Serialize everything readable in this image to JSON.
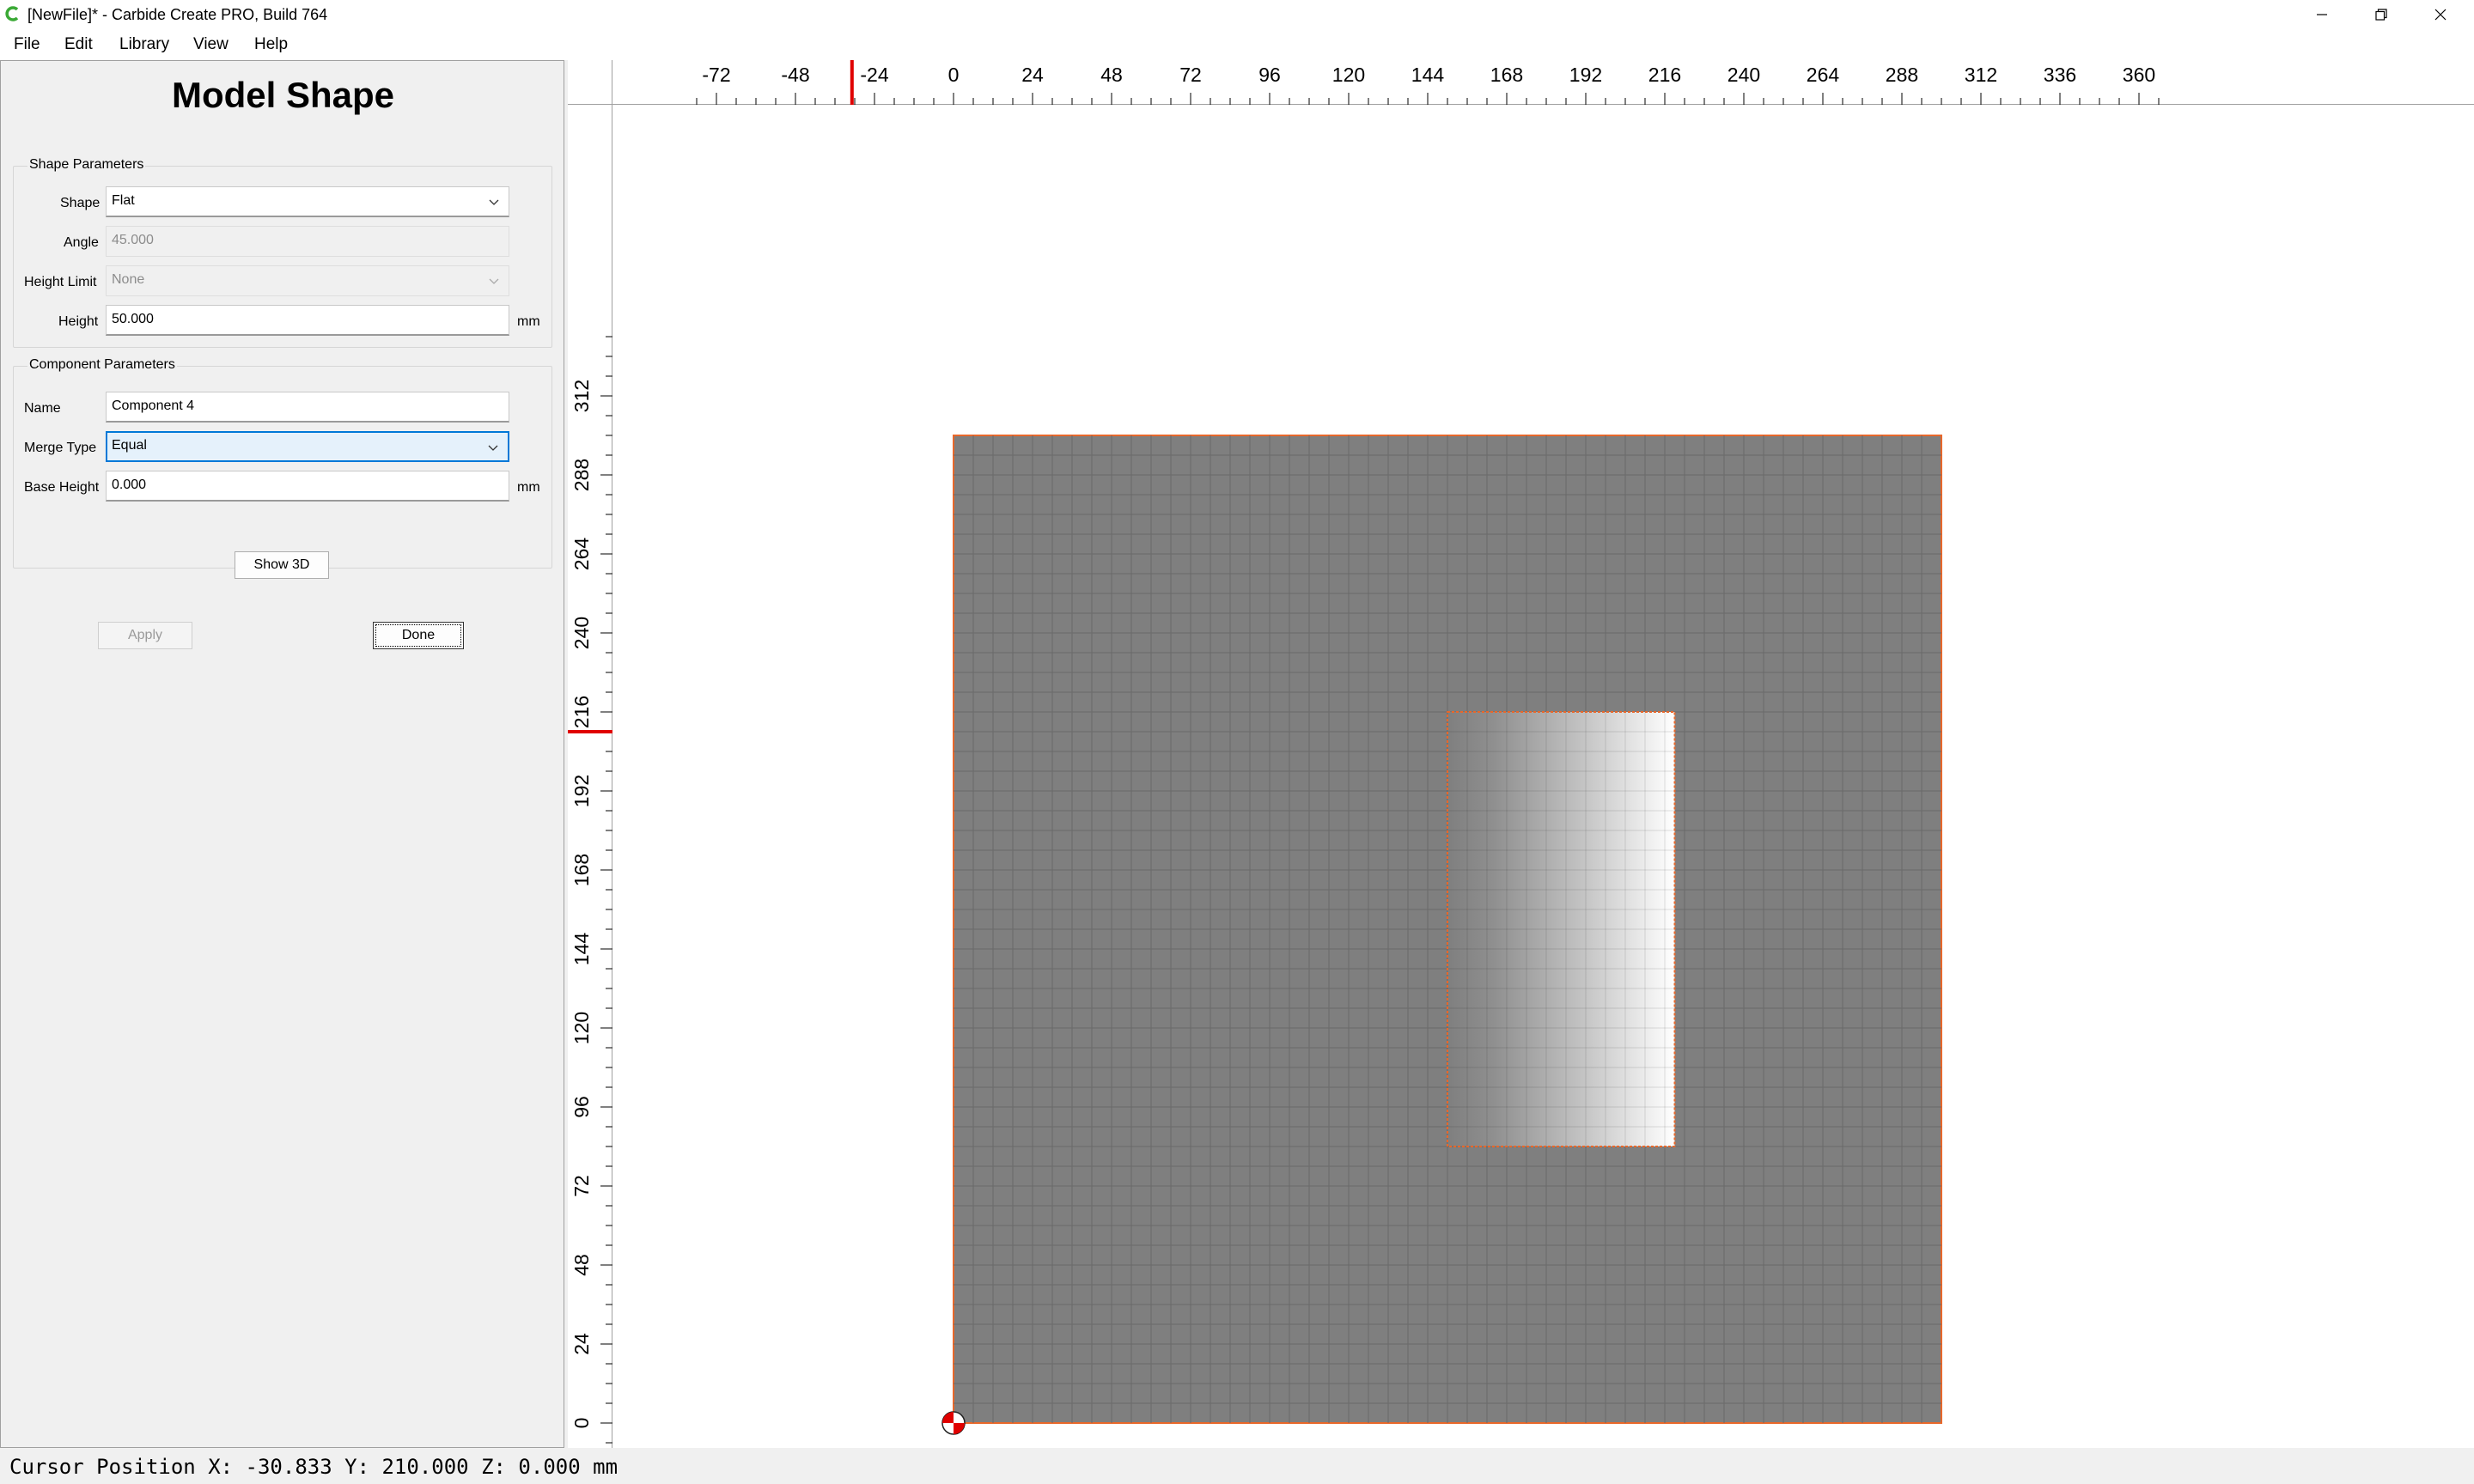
{
  "window": {
    "title": "[NewFile]* - Carbide Create PRO, Build 764",
    "app_icon": "carbide-create-icon",
    "controls": [
      "minimize-icon",
      "restore-icon",
      "close-icon"
    ]
  },
  "menu": [
    "File",
    "Edit",
    "Library",
    "View",
    "Help"
  ],
  "panel": {
    "title": "Model Shape",
    "shape_params": {
      "group_title": "Shape Parameters",
      "shape_label": "Shape",
      "shape_value": "Flat",
      "angle_label": "Angle",
      "angle_value": "45.000",
      "height_limit_label": "Height Limit",
      "height_limit_value": "None",
      "height_label": "Height",
      "height_value": "50.000",
      "height_unit": "mm"
    },
    "component_params": {
      "group_title": "Component Parameters",
      "name_label": "Name",
      "name_value": "Component 4",
      "merge_type_label": "Merge Type",
      "merge_type_value": "Equal",
      "base_height_label": "Base Height",
      "base_height_value": "0.000",
      "base_height_unit": "mm"
    },
    "show3d_label": "Show 3D",
    "apply_label": "Apply",
    "done_label": "Done"
  },
  "canvas": {
    "x_ticks": [
      "-72",
      "-48",
      "-24",
      "0",
      "24",
      "48",
      "72",
      "96",
      "120",
      "144",
      "168",
      "192",
      "216",
      "240",
      "264",
      "288",
      "312",
      "336",
      "360"
    ],
    "y_ticks": [
      "312",
      "288",
      "264",
      "240",
      "216",
      "192",
      "168",
      "144",
      "120",
      "96",
      "72",
      "48",
      "24",
      "0"
    ],
    "stock_width": 300,
    "stock_height": 300,
    "selected_rect": {
      "x1": 150,
      "y1": 84,
      "x2": 219,
      "y2": 216
    },
    "cursor_x": -30.833,
    "cursor_y": 210.0,
    "colors": {
      "stock": "#7f7f7f",
      "grid": "#6a6a6a",
      "outline": "#e8672a",
      "cursor_marker": "#e00000",
      "origin_marker": "#e00000"
    }
  },
  "status": {
    "cursor_position": "Cursor Position X: -30.833 Y: 210.000 Z: 0.000 mm"
  }
}
